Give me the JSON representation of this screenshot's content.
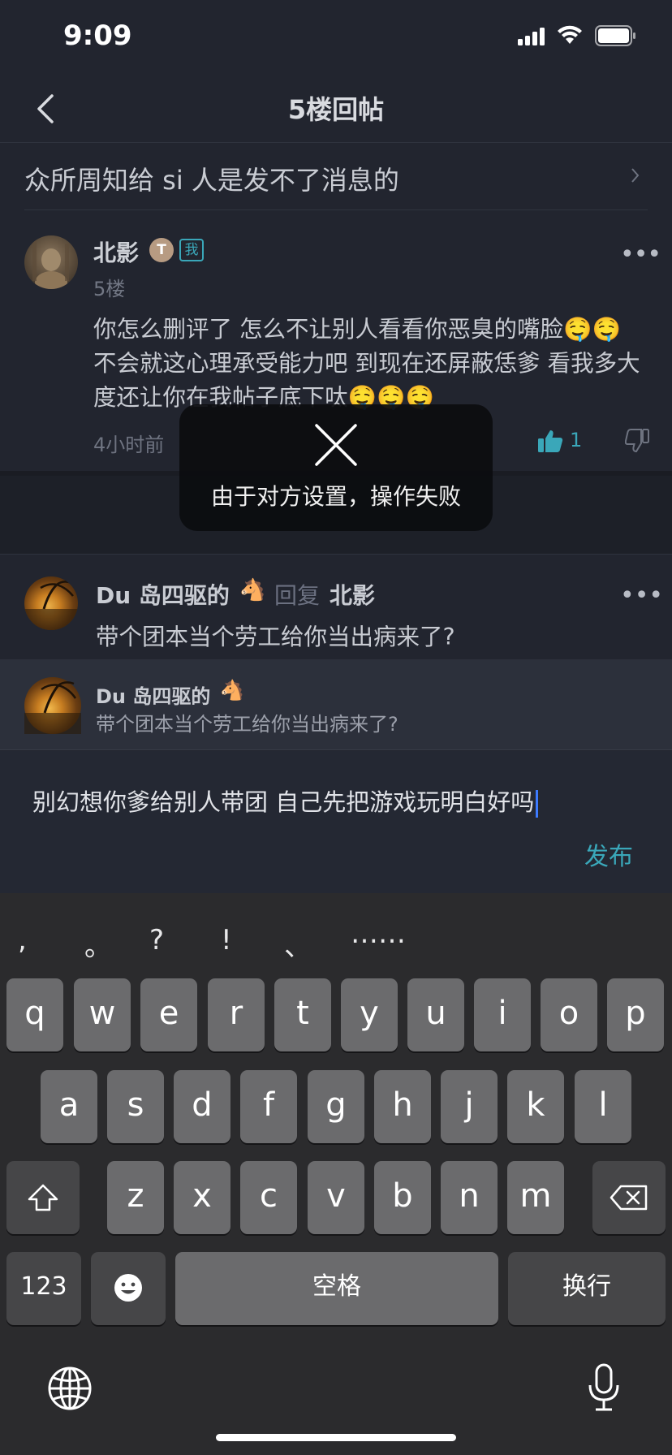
{
  "status_bar": {
    "time": "9:09"
  },
  "nav": {
    "title": "5楼回帖"
  },
  "thread": {
    "title": "众所周知给 si 人是发不了消息的"
  },
  "post": {
    "author": "北影",
    "level_badge": "T",
    "me_badge": "我",
    "floor": "5楼",
    "body": "你怎么删评了 怎么不让别人看看你恶臭的嘴脸🤤🤤 不会就这心理承受能力吧 到现在还屏蔽恁爹 看我多大度还让你在我帖子底下呔🤤🤤🤤",
    "time": "4小时前",
    "likes": "1",
    "more": "•••"
  },
  "reply": {
    "author": "Du 岛四驱的",
    "author_emoji": "🐴",
    "verb": "回复",
    "target": "北影",
    "body": "带个团本当个劳工给你当出病来了?",
    "more": "•••"
  },
  "quote": {
    "author": "Du 岛四驱的",
    "author_emoji": "🐴",
    "text": "带个团本当个劳工给你当出病来了?"
  },
  "compose": {
    "text": "别幻想你爹给别人带团 自己先把游戏玩明白好吗",
    "publish_label": "发布"
  },
  "toast": {
    "message": "由于对方设置，操作失败"
  },
  "keyboard": {
    "punctuation": [
      ",",
      "。",
      "?",
      "!",
      "、",
      "……"
    ],
    "row1": [
      "q",
      "w",
      "e",
      "r",
      "t",
      "y",
      "u",
      "i",
      "o",
      "p"
    ],
    "row2": [
      "a",
      "s",
      "d",
      "f",
      "g",
      "h",
      "j",
      "k",
      "l"
    ],
    "row3": [
      "z",
      "x",
      "c",
      "v",
      "b",
      "n",
      "m"
    ],
    "numbers_label": "123",
    "space_label": "空格",
    "return_label": "换行"
  },
  "colors": {
    "accent": "#3aa7b9",
    "background": "#22252f",
    "toast": "#0c0d10"
  }
}
